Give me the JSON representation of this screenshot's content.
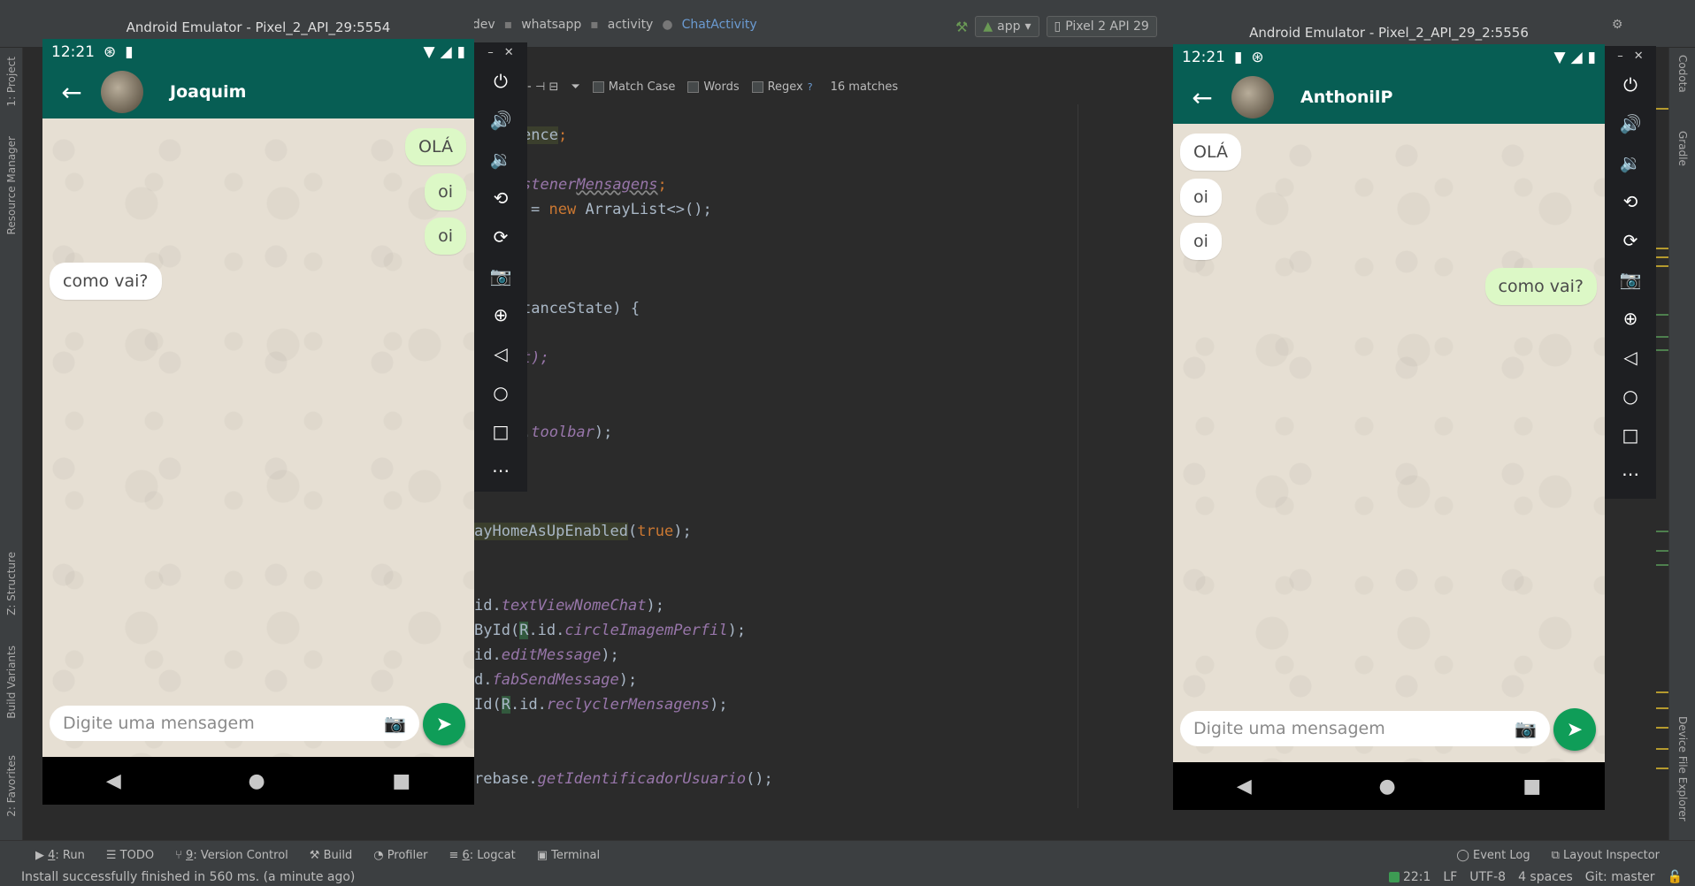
{
  "ide": {
    "breadcrumbs": [
      "idev",
      "whatsapp",
      "activity",
      "ChatActivity"
    ],
    "run_config": "app",
    "device_combo": "Pixel 2 API 29",
    "find": {
      "match_case": "Match Case",
      "words": "Words",
      "regex": "Regex",
      "help": "?",
      "matches": "16 matches"
    },
    "left_panels": [
      "1: Project",
      "Resource Manager",
      "Z: Structure",
      "Build Variants",
      "2: Favorites"
    ],
    "right_panels": [
      "Codota",
      "Gradle",
      "Device File Explorer"
    ],
    "bottom_tabs": [
      {
        "key": "4",
        "label": ": Run"
      },
      {
        "key": "",
        "label": "TODO"
      },
      {
        "key": "9",
        "label": ": Version Control"
      },
      {
        "key": "",
        "label": "Build"
      },
      {
        "key": "",
        "label": "Profiler"
      },
      {
        "key": "6",
        "label": ": Logcat"
      },
      {
        "key": "",
        "label": "Terminal"
      }
    ],
    "bottom_right_tabs": [
      "Event Log",
      "Layout Inspector"
    ],
    "status_message": "Install successfully finished in 560 ms. (a minute ago)",
    "status_right": {
      "position": "22:1",
      "line_sep": "LF",
      "encoding": "UTF-8",
      "indent": "4 spaces",
      "vcs": "Git: master"
    }
  },
  "code_lines": [
    {
      "t1": "",
      "a": "ence",
      "b": ";"
    },
    {
      "t1": "stener",
      "a": "Mensagens",
      "b": ";"
    },
    {
      "t1": "= ",
      "kw": "new",
      "b": " ArrayList<>();"
    },
    {
      "t1": "tanceState) {"
    },
    {
      "t1": "t);"
    },
    {
      "t1": ".",
      "fld": "toolbar",
      "b": ");"
    },
    {
      "t1": "ayHomeAsUpEnabled",
      "b": "(",
      "kw": "true",
      "c": ");"
    },
    {
      "t1": "id.",
      "fld": "textViewNomeChat",
      "b": ");"
    },
    {
      "t1": "ById(",
      "hl": "R",
      "m": ".id.",
      "fld": "circleImagemPerfil",
      "b": ");"
    },
    {
      "t1": "id.",
      "fld": "editMessage",
      "b": ");"
    },
    {
      "t1": "d.",
      "fld": "fabSendMessage",
      "b": ");"
    },
    {
      "t1": "Id(",
      "hl": "R",
      "m": ".id.",
      "fld": "reclyclerMensagens",
      "b": ");"
    },
    {
      "t1": "rebase.",
      "fld": "getIdentificadorUsuario",
      "b": "();"
    }
  ],
  "emulator_left": {
    "title": "Android Emulator - Pixel_2_API_29:5554",
    "time": "12:21",
    "contact": "Joaquim",
    "messages": [
      {
        "text": "OLÁ",
        "dir": "sent"
      },
      {
        "text": "oi",
        "dir": "sent"
      },
      {
        "text": "oi",
        "dir": "sent"
      },
      {
        "text": "como vai?",
        "dir": "recv"
      }
    ],
    "placeholder": "Digite uma mensagem"
  },
  "emulator_right": {
    "title": "Android Emulator - Pixel_2_API_29_2:5556",
    "time": "12:21",
    "contact": "AnthonilP",
    "messages": [
      {
        "text": "OLÁ",
        "dir": "recv"
      },
      {
        "text": "oi",
        "dir": "recv"
      },
      {
        "text": "oi",
        "dir": "recv"
      },
      {
        "text": "como vai?",
        "dir": "sent"
      }
    ],
    "placeholder": "Digite uma mensagem"
  },
  "emulator_tools": [
    "power-icon",
    "volume-up-icon",
    "volume-down-icon",
    "rotate-left-icon",
    "rotate-right-icon",
    "camera-icon",
    "zoom-icon",
    "back-icon",
    "home-icon",
    "overview-icon",
    "more-icon"
  ],
  "colors": {
    "whatsapp_green": "#075e54",
    "sent_bubble": "#dcf8c6",
    "fab": "#0f9d58"
  }
}
